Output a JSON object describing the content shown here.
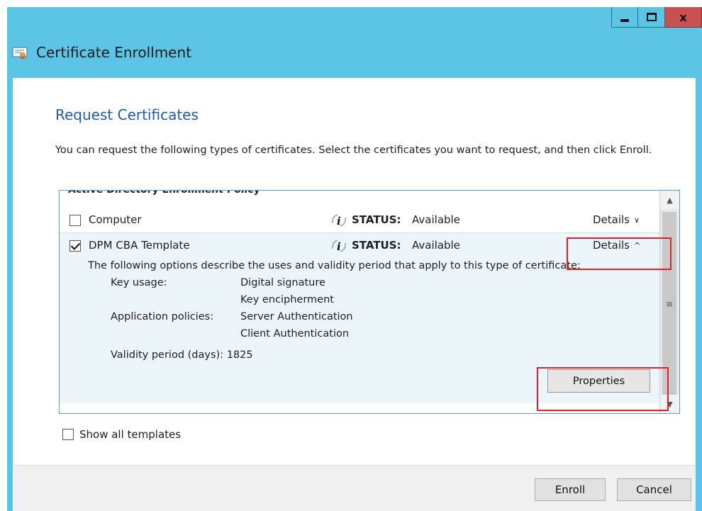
{
  "window": {
    "title": "Certificate Enrollment",
    "controls": {
      "minimize_icon": "minimize-icon",
      "maximize_icon": "maximize-icon",
      "close_glyph": "x"
    }
  },
  "page": {
    "title": "Request Certificates",
    "description": "You can request the following types of certificates. Select the certificates you want to request, and then click Enroll."
  },
  "policy": {
    "header": "Active Directory Enrollment Policy",
    "certificates": [
      {
        "name": "Computer",
        "checked": false,
        "status_label": "STATUS:",
        "status_value": "Available",
        "details_label": "Details",
        "details_icon": "chevron-down-icon",
        "details_glyph": "∨"
      },
      {
        "name": "DPM CBA Template",
        "checked": true,
        "status_label": "STATUS:",
        "status_value": "Available",
        "details_label": "Details",
        "details_icon": "chevron-up-icon",
        "details_glyph": "^",
        "detail_description": "The following options describe the uses and validity period that apply to this type of certificate:",
        "key_usage_label": "Key usage:",
        "key_usage_values": [
          "Digital signature",
          "Key encipherment"
        ],
        "app_policies_label": "Application policies:",
        "app_policies_values": [
          "Server Authentication",
          "Client Authentication"
        ],
        "validity_label": "Validity period (days):",
        "validity_value": "1825",
        "properties_button": "Properties"
      }
    ]
  },
  "show_all_templates": {
    "label": "Show all templates",
    "checked": false
  },
  "footer": {
    "enroll_label": "Enroll",
    "cancel_label": "Cancel"
  },
  "colors": {
    "title_bar": "#5cc5e6",
    "page_title": "#1e5aa8",
    "selected_row": "#ecf5fa",
    "highlight": "#e0202a",
    "close_button": "#c75050"
  }
}
